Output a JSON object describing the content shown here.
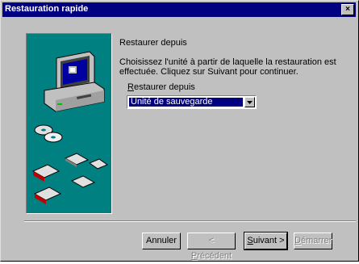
{
  "window": {
    "title": "Restauration rapide",
    "close_glyph": "×"
  },
  "content": {
    "heading": "Restaurer depuis",
    "description": "Choisissez l'unité à partir de laquelle la restauration est effectuée. Cliquez sur Suivant pour continuer.",
    "field_label": "Restaurer depuis",
    "dropdown_value": "Unité de sauvegarde"
  },
  "buttons": {
    "cancel": "Annuler",
    "back": "< Précédent",
    "next": "Suivant >",
    "start": "Démarrer"
  },
  "colors": {
    "art_background": "#008080",
    "titlebar": "#000080"
  }
}
